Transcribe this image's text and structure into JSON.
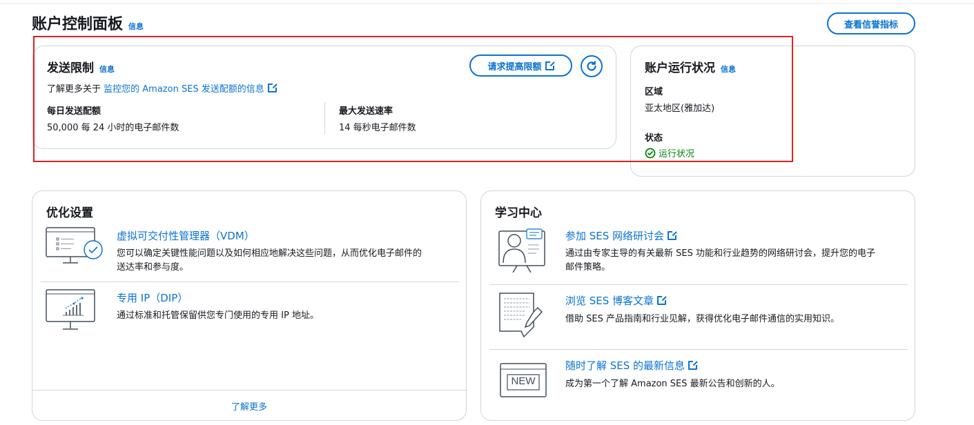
{
  "header": {
    "title": "账户控制面板",
    "info": "信息",
    "reputation_button": "查看信誉指标"
  },
  "sending_limits": {
    "title": "发送限制",
    "info": "信息",
    "request_button": "请求提高限额",
    "learn_prefix": "了解更多关于",
    "learn_link": "监控您的 Amazon SES 发送配额的信息",
    "daily_label": "每日发送配额",
    "daily_value": "50,000 每 24 小时的电子邮件数",
    "rate_label": "最大发送速率",
    "rate_value": "14 每秒电子邮件数"
  },
  "account_health": {
    "title": "账户运行状况",
    "info": "信息",
    "region_label": "区域",
    "region_value": "亚太地区(雅加达)",
    "status_label": "状态",
    "status_value": "运行状况"
  },
  "optimization": {
    "title": "优化设置",
    "items": [
      {
        "link": "虚拟可交付性管理器（VDM）",
        "desc_line1": "您可以确定关键性能问题以及如何相应地解决这些问题，从而优化电子邮件的",
        "desc_line2": "送达率和参与度。",
        "icon": "monitor-checklist-icon"
      },
      {
        "link": "专用 IP（DIP）",
        "desc_line1": "通过标准和托管保留供您专门使用的专用 IP 地址。",
        "icon": "monitor-chart-icon"
      }
    ],
    "footer_link": "了解更多"
  },
  "learning": {
    "title": "学习中心",
    "items": [
      {
        "link": "参加 SES 网络研讨会",
        "desc_line1": "通过由专家主导的有关最新 SES 功能和行业趋势的网络研讨会，提升您的电子",
        "desc_line2": "邮件策略。",
        "icon": "webinar-icon"
      },
      {
        "link": "浏览 SES 博客文章",
        "desc_line1": "借助 SES 产品指南和行业见解，获得优化电子邮件通信的实用知识。",
        "icon": "blog-document-icon"
      },
      {
        "link": "随时了解 SES 的最新信息",
        "desc_line1": "成为第一个了解 Amazon SES 最新公告和创新的人。",
        "icon_text": "NEW",
        "icon": "new-announcement-icon"
      }
    ]
  },
  "colors": {
    "accent": "#0972d3",
    "success": "#037f0c",
    "highlight_box": "#e02020",
    "border": "#d1d5db"
  }
}
